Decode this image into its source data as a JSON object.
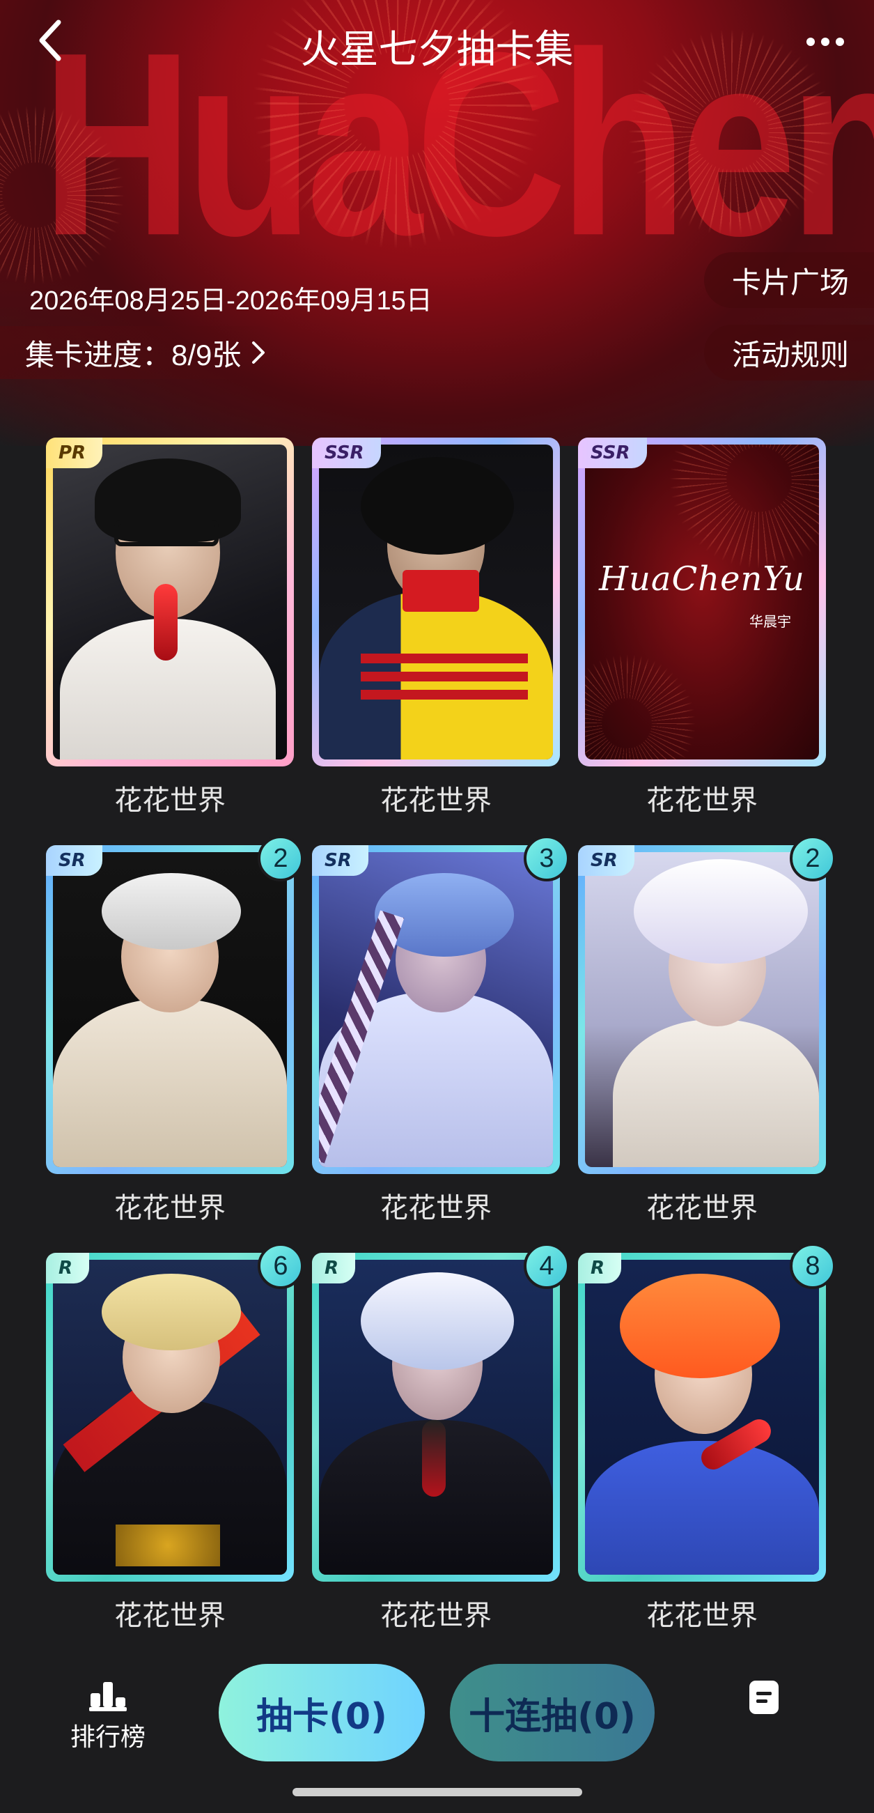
{
  "header": {
    "title": "火星七夕抽卡集",
    "banner_text": "HuaChenYu"
  },
  "event": {
    "date_range": "2026年08月25日-2026年09月15日",
    "progress_label": "集卡进度：8/9张",
    "card_plaza_label": "卡片广场",
    "rules_label": "活动规则"
  },
  "cards": [
    {
      "rarity": "PR",
      "name": "花花世界",
      "count": ""
    },
    {
      "rarity": "SSR",
      "name": "花花世界",
      "count": ""
    },
    {
      "rarity": "SSR",
      "name": "花花世界",
      "count": "",
      "logo": "HuaChenYu",
      "logo_sub": "华晨宇"
    },
    {
      "rarity": "SR",
      "name": "花花世界",
      "count": "2"
    },
    {
      "rarity": "SR",
      "name": "花花世界",
      "count": "3"
    },
    {
      "rarity": "SR",
      "name": "花花世界",
      "count": "2"
    },
    {
      "rarity": "R",
      "name": "花花世界",
      "count": "6"
    },
    {
      "rarity": "R",
      "name": "花花世界",
      "count": "4"
    },
    {
      "rarity": "R",
      "name": "花花世界",
      "count": "8"
    }
  ],
  "bottom": {
    "ranking_label": "排行榜",
    "draw_one_label": "抽卡(0)",
    "draw_ten_label": "十连抽(0)"
  },
  "icons": {
    "back": "chevron-left-icon",
    "more": "more-dots-icon",
    "progress_arrow": "chevron-right-icon",
    "ranking": "podium-icon",
    "note": "note-icon"
  },
  "colors": {
    "banner_red": "#c0121c",
    "page_bg": "#1c1c1e",
    "draw_btn_text": "#123a86",
    "badge_teal": "#40c7d9"
  }
}
